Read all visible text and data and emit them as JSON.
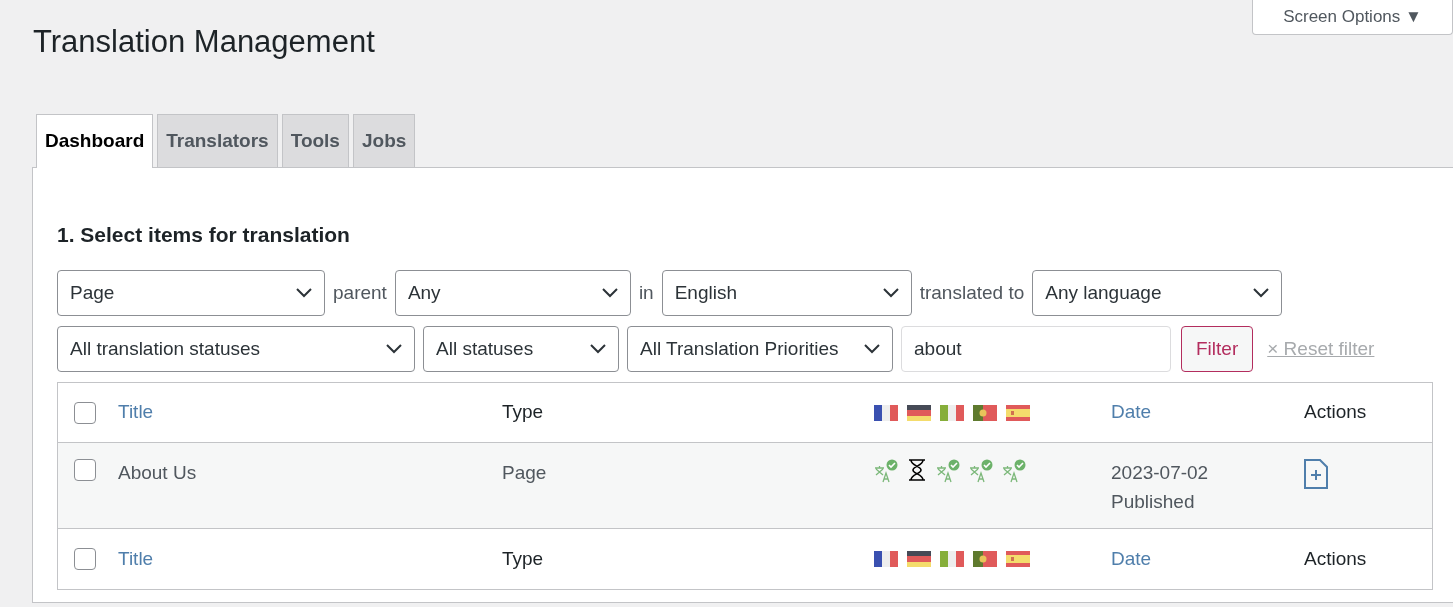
{
  "screen_options": {
    "label": "Screen Options ▼"
  },
  "page_title": "Translation Management",
  "tabs": [
    {
      "label": "Dashboard",
      "selected": true
    },
    {
      "label": "Translators",
      "selected": false
    },
    {
      "label": "Tools",
      "selected": false
    },
    {
      "label": "Jobs",
      "selected": false
    }
  ],
  "section_title": "1. Select items for translation",
  "filters_row_1": [
    {
      "kind": "select",
      "value": "Page"
    },
    {
      "kind": "text",
      "text": "parent"
    },
    {
      "kind": "select",
      "value": "Any"
    },
    {
      "kind": "text",
      "text": "in"
    },
    {
      "kind": "select",
      "value": "English"
    },
    {
      "kind": "text",
      "text": "translated to"
    },
    {
      "kind": "select",
      "value": "Any language"
    }
  ],
  "filters_row_2": [
    {
      "kind": "select",
      "value": "All translation statuses"
    },
    {
      "kind": "select",
      "value": "All statuses"
    },
    {
      "kind": "select",
      "value": "All Translation Priorities"
    },
    {
      "kind": "input",
      "value": "about"
    },
    {
      "kind": "button",
      "text": "Filter"
    },
    {
      "kind": "reset",
      "text": "× Reset filter"
    }
  ],
  "table": {
    "header": {
      "checked": false,
      "title": "Title",
      "type": "Type",
      "flags": [
        {
          "kind": "fr"
        },
        {
          "kind": "de"
        },
        {
          "kind": "it"
        },
        {
          "kind": "pt"
        },
        {
          "kind": "es"
        }
      ],
      "date": "Date",
      "actions": "Actions"
    },
    "rows": [
      {
        "checked": false,
        "title": "About Us",
        "type": "Page",
        "statuses": [
          {
            "kind": "translated"
          },
          {
            "kind": "in_progress"
          },
          {
            "kind": "translated"
          },
          {
            "kind": "translated"
          },
          {
            "kind": "translated"
          }
        ],
        "date": "2023-07-02",
        "status": "Published"
      }
    ],
    "footer": {
      "checked": false,
      "title": "Title",
      "type": "Type",
      "flags": [
        {
          "kind": "fr"
        },
        {
          "kind": "de"
        },
        {
          "kind": "it"
        },
        {
          "kind": "pt"
        },
        {
          "kind": "es"
        }
      ],
      "date": "Date",
      "actions": "Actions"
    }
  }
}
